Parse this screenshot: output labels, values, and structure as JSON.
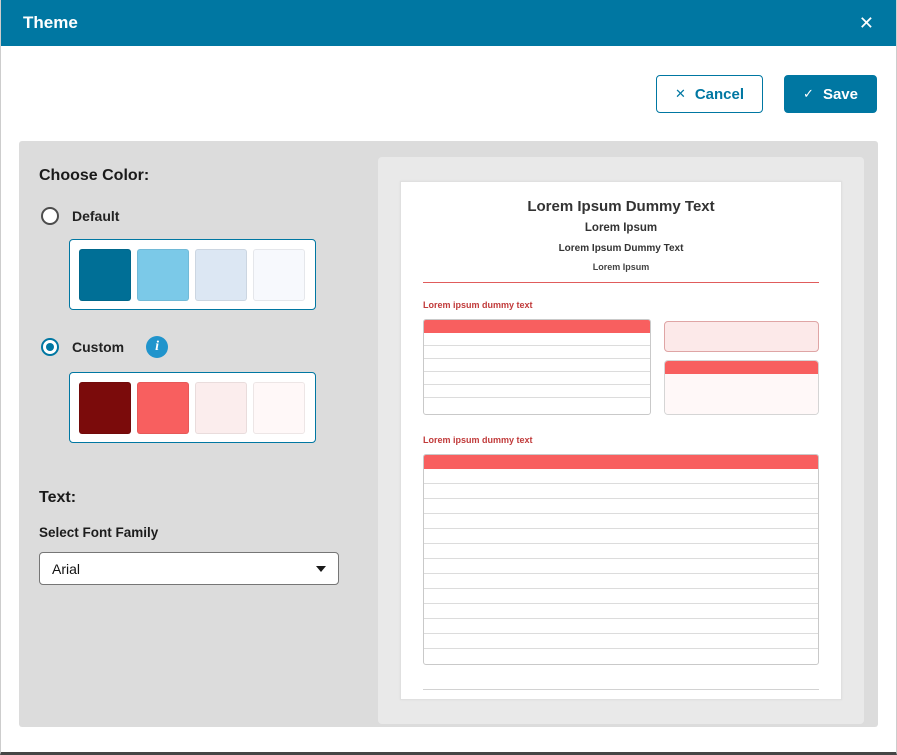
{
  "modal": {
    "title": "Theme",
    "close_glyph": "✕"
  },
  "actions": {
    "cancel": {
      "label": "Cancel",
      "icon": "✕"
    },
    "save": {
      "label": "Save",
      "icon": "✓"
    }
  },
  "color_section": {
    "heading": "Choose Color:",
    "info_glyph": "i",
    "options": [
      {
        "label": "Default",
        "selected": false,
        "swatches": [
          "#006F96",
          "#7BC9E8",
          "#DCE7F3",
          "#F7F9FD"
        ]
      },
      {
        "label": "Custom",
        "selected": true,
        "swatches": [
          "#7B0B0B",
          "#F85F5F",
          "#FBEDED",
          "#FFF8F8"
        ]
      }
    ]
  },
  "text_section": {
    "heading": "Text:",
    "font_label": "Select Font Family",
    "font_value": "Arial"
  },
  "preview": {
    "heading": "Lorem Ipsum Dummy Text",
    "line2": "Lorem Ipsum",
    "line3": "Lorem Ipsum Dummy Text",
    "line4": "Lorem Ipsum",
    "caption1": "Lorem ipsum dummy text",
    "caption2": "Lorem ipsum dummy text",
    "table1_rows": 6,
    "table2_rows": 13,
    "accent_color": "#F85F5F"
  },
  "theme_colors": {
    "primary": "#0077A2",
    "info_blue": "#2094CC",
    "panel_bg": "#DCDCDC",
    "accent_red": "#F85F5F",
    "caption_red": "#C13A3A"
  }
}
